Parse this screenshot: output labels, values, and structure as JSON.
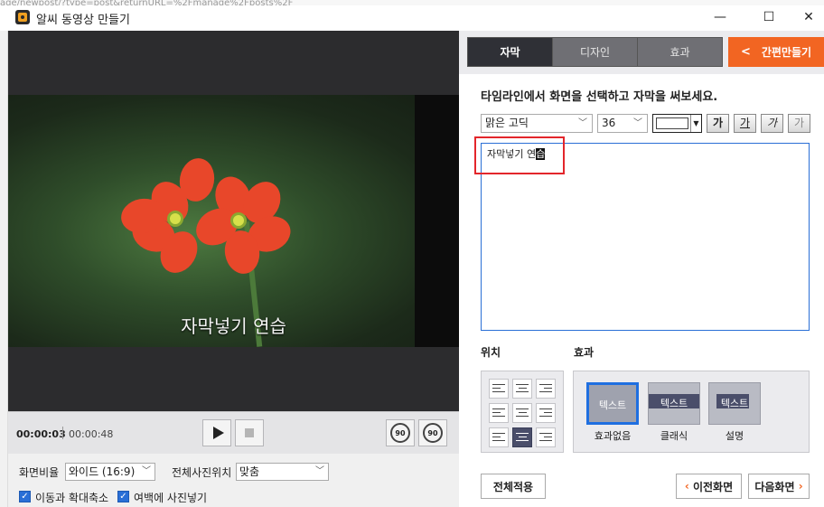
{
  "window": {
    "title": "알씨 동영상 만들기",
    "minimize_glyph": "—",
    "maximize_glyph": "☐",
    "close_glyph": "✕"
  },
  "background_url_fragment": "age/newpost/?type=post&returnURL=%2Fmanage%2Fposts%2F",
  "preview": {
    "subtitle_text": "자막넣기 연습",
    "current_time": "00:00:03",
    "total_time": "00:00:48",
    "seek_back_label": "90",
    "seek_forward_label": "90",
    "aspect_label": "화면비율",
    "aspect_value": "와이드 (16:9)",
    "photo_pos_label": "전체사진위치",
    "photo_pos_value": "맞춤",
    "check_move_zoom": "이동과 확대축소",
    "check_fill_margin": "여백에 사진넣기"
  },
  "tabs": [
    {
      "label": "자막",
      "active": true
    },
    {
      "label": "디자인",
      "active": false
    },
    {
      "label": "효과",
      "active": false
    }
  ],
  "easy_button_label": "간편만들기",
  "instruction": "타임라인에서 화면을 선택하고 자막을 써보세요.",
  "format": {
    "font_value": "맑은 고딕",
    "size_value": "36",
    "text_color": "#ffffff",
    "style_buttons": [
      "가",
      "가",
      "가",
      "가"
    ]
  },
  "caption_text_plain": "자막넣기 연",
  "caption_text_selected": "습",
  "position_label": "위치",
  "effects_label": "효과",
  "effects": [
    {
      "label": "효과없음",
      "sample": "텍스트",
      "active": true
    },
    {
      "label": "클래식",
      "sample": "텍스트",
      "active": false
    },
    {
      "label": "설명",
      "sample": "텍스트",
      "active": false
    }
  ],
  "buttons": {
    "apply_all": "전체적용",
    "prev_screen": "이전화면",
    "next_screen": "다음화면"
  },
  "colors": {
    "accent_orange": "#f26522",
    "highlight_red": "#e3262b",
    "selection_blue": "#1f6fe0",
    "tab_active": "#2f3036"
  }
}
